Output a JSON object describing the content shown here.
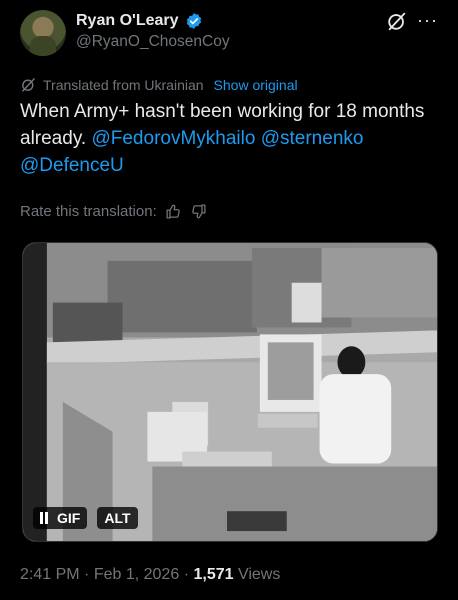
{
  "author": {
    "name": "Ryan O'Leary",
    "handle": "@RyanO_ChosenCoy",
    "verified_color": "#1d9bf0"
  },
  "translation": {
    "label": "Translated from Ukrainian",
    "show_original": "Show original"
  },
  "tweet": {
    "text_line": "When Army+ hasn't been working for 18 months already.",
    "mentions": [
      "@FedorovMykhailo",
      "@sternenko",
      "@DefenceU"
    ]
  },
  "rate": {
    "label": "Rate this translation:"
  },
  "media": {
    "gif_badge": "GIF",
    "alt_badge": "ALT",
    "pause_icon": "pause-icon"
  },
  "meta": {
    "time": "2:41 PM",
    "date": "Feb 1, 2026",
    "views_count": "1,571",
    "views_label": "Views"
  },
  "colors": {
    "background": "#000000",
    "text": "#e7e9ea",
    "muted": "#71767b",
    "link": "#1d9bf0"
  }
}
